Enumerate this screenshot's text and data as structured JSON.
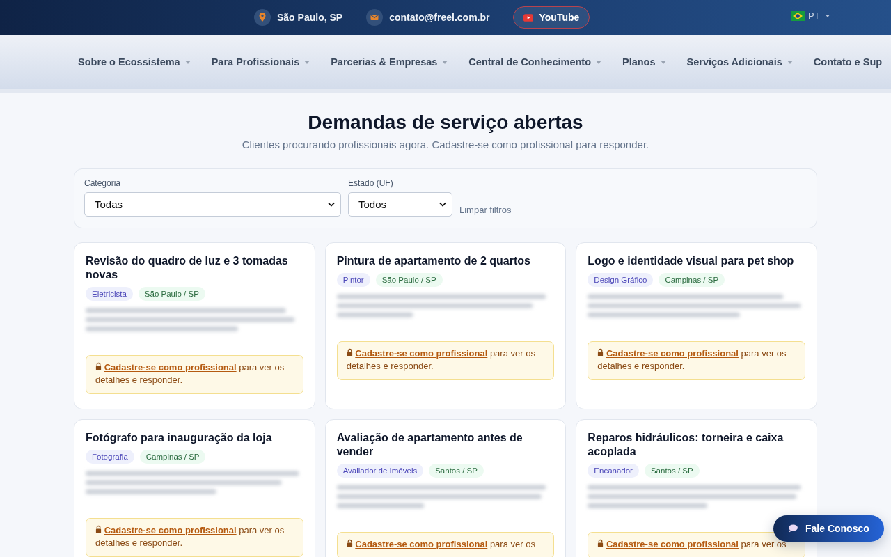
{
  "topbar": {
    "location": "São Paulo, SP",
    "email": "contato@freel.com.br",
    "youtube": "YouTube",
    "language": "PT"
  },
  "nav": [
    {
      "label": "Sobre o Ecossistema",
      "caret": true
    },
    {
      "label": "Para Profissionais",
      "caret": true
    },
    {
      "label": "Parcerias & Empresas",
      "caret": true
    },
    {
      "label": "Central de Conhecimento",
      "caret": true
    },
    {
      "label": "Planos",
      "caret": true
    },
    {
      "label": "Serviços Adicionais",
      "caret": true
    },
    {
      "label": "Contato e Sup",
      "caret": false
    }
  ],
  "heading": "Demandas de serviço abertas",
  "subheading": "Clientes procurando profissionais agora. Cadastre-se como profissional para responder.",
  "filters": [
    {
      "label": "Categoria",
      "value": "Todas",
      "kind": "wide"
    },
    {
      "label": "Estado (UF)",
      "value": "Todos",
      "kind": "narrow"
    }
  ],
  "clear_filters": "Limpar filtros",
  "cards": [
    {
      "title": "Revisão do quadro de luz e 3 tomadas novas",
      "category": "Eletricista",
      "location": "São Paulo / SP",
      "notice_link": "Cadastre-se como profissional",
      "notice_text": "para ver os detalhes e responder."
    },
    {
      "title": "Pintura de apartamento de 2 quartos",
      "category": "Pintor",
      "location": "São Paulo / SP",
      "notice_link": "Cadastre-se como profissional",
      "notice_text": "para ver os detalhes e responder."
    },
    {
      "title": "Logo e identidade visual para pet shop",
      "category": "Design Gráfico",
      "location": "Campinas / SP",
      "notice_link": "Cadastre-se como profissional",
      "notice_text": "para ver os detalhes e responder."
    },
    {
      "title": "Fotógrafo para inauguração da loja",
      "category": "Fotografia",
      "location": "Campinas / SP",
      "notice_link": "Cadastre-se como profissional",
      "notice_text": "para ver os detalhes e responder."
    },
    {
      "title": "Avaliação de apartamento antes de vender",
      "category": "Avaliador de Imóveis",
      "location": "Santos / SP",
      "notice_link": "Cadastre-se como profissional",
      "notice_text": "para ver os"
    },
    {
      "title": "Reparos hidráulicos: torneira e caixa acoplada",
      "category": "Encanador",
      "location": "Santos / SP",
      "notice_link": "Cadastre-se como profissional",
      "notice_text": "para ver os"
    }
  ],
  "chat_button": "Fale Conosco"
}
